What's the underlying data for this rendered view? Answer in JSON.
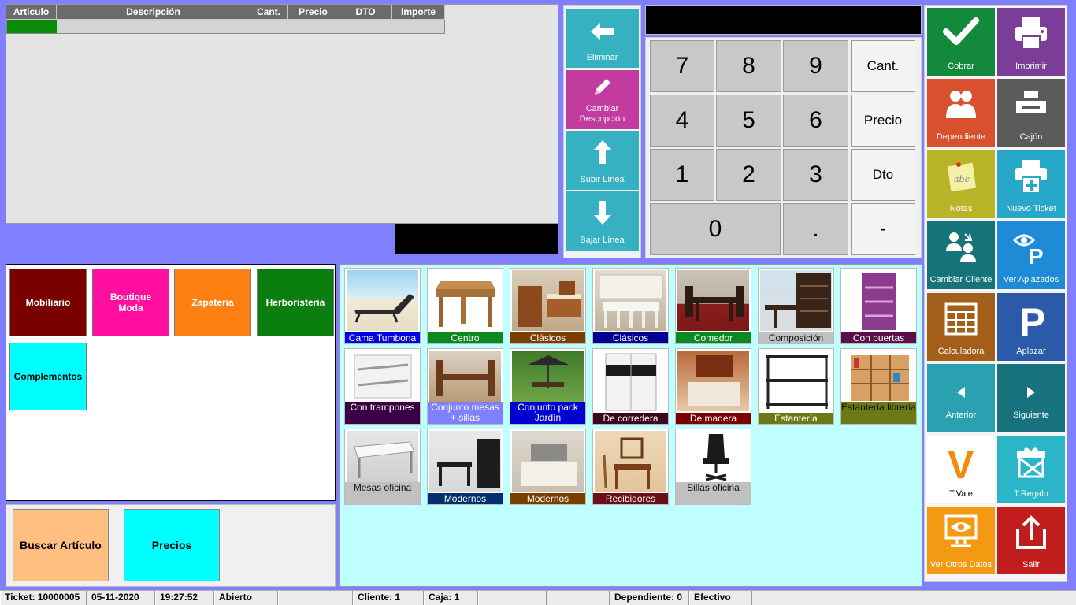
{
  "ticket_table": {
    "columns": [
      "Articulo",
      "Descripción",
      "Cant.",
      "Precio",
      "DTO",
      "Importe"
    ]
  },
  "actions": [
    {
      "label": "Eliminar",
      "color": "#36b1c2",
      "icon": "arrow-left-icon"
    },
    {
      "label": "Cambiar Descripción",
      "color": "#c23b9e",
      "icon": "pencil-icon"
    },
    {
      "label": "Subir Línea",
      "color": "#36b1c2",
      "icon": "arrow-up-icon"
    },
    {
      "label": "Bajar Línea",
      "color": "#36b1c2",
      "icon": "arrow-down-icon"
    }
  ],
  "keypad": {
    "k7": "7",
    "k8": "8",
    "k9": "9",
    "k4": "4",
    "k5": "5",
    "k6": "6",
    "k1": "1",
    "k2": "2",
    "k3": "3",
    "k0": "0",
    "kdot": ".",
    "kminus": "-",
    "cant": "Cant.",
    "precio": "Precio",
    "dto": "Dto"
  },
  "tiles": [
    {
      "label": "Cobrar",
      "color": "#138a3b",
      "icon": "checkmark-icon"
    },
    {
      "label": "Imprimir",
      "color": "#7a3d98",
      "icon": "printer-icon"
    },
    {
      "label": "Dependiente",
      "color": "#d9502f",
      "icon": "users-icon"
    },
    {
      "label": "Cajón",
      "color": "#5b5b5b",
      "icon": "cash-drawer-icon"
    },
    {
      "label": "Notas",
      "color": "#b9b328",
      "icon": "sticky-note-icon"
    },
    {
      "label": "Nuevo Ticket",
      "color": "#27a8c8",
      "icon": "printer-plus-icon"
    },
    {
      "label": "Cambiar Cliente",
      "color": "#17737a",
      "icon": "swap-users-icon"
    },
    {
      "label": "Ver Aplazados",
      "color": "#1e8bd6",
      "icon": "eye-parking-icon"
    },
    {
      "label": "Calculadora",
      "color": "#a35f1a",
      "icon": "calculator-icon"
    },
    {
      "label": "Aplazar",
      "color": "#2a5aa8",
      "icon": "parking-icon"
    },
    {
      "label": "Anterior",
      "color": "#2aa1b1",
      "icon": "triangle-left-icon"
    },
    {
      "label": "Siguiente",
      "color": "#17727e",
      "icon": "triangle-right-icon"
    },
    {
      "label": "T.Vale",
      "color": "#ffffff",
      "icon": "letter-v-icon"
    },
    {
      "label": "T.Regalo",
      "color": "#2ab5c8",
      "icon": "gift-icon"
    },
    {
      "label": "Ver Otros Datos",
      "color": "#f39a12",
      "icon": "monitor-eye-icon"
    },
    {
      "label": "Salir",
      "color": "#c21d1d",
      "icon": "export-icon"
    }
  ],
  "families": [
    {
      "label": "Mobiliario",
      "bg": "#7a0000",
      "fg": "#ffffff"
    },
    {
      "label": "Boutique Moda",
      "bg": "#ff0ea0",
      "fg": "#ffffff"
    },
    {
      "label": "Zapateria",
      "bg": "#ff8012",
      "fg": "#ffffff"
    },
    {
      "label": "Herboristeria",
      "bg": "#0a7f10",
      "fg": "#ffffff"
    },
    {
      "label": "Complementos",
      "bg": "#00ffff",
      "fg": "#000000"
    }
  ],
  "bottom_buttons": {
    "buscar": "Buscar Artículo",
    "precios": "Precios"
  },
  "products": [
    {
      "label": "Cama Tumbona",
      "color": "#0000e0"
    },
    {
      "label": "Centro",
      "color": "#0a8a1e"
    },
    {
      "label": "Clásicos",
      "color": "#7a3e00"
    },
    {
      "label": "Clásicos",
      "color": "#000090"
    },
    {
      "label": "Comedor",
      "color": "#0a8a1e"
    },
    {
      "label": "Composición",
      "color": "#c0c0c0"
    },
    {
      "label": "Con puertas",
      "color": "#5a0f4a"
    },
    {
      "label": "Con trampones",
      "color": "#3a0044"
    },
    {
      "label": "Conjunto mesas + sillas",
      "color": "#8080ff"
    },
    {
      "label": "Conjunto pack Jardín",
      "color": "#0000d0"
    },
    {
      "label": "De corredera",
      "color": "#3c0620"
    },
    {
      "label": "De madera",
      "color": "#7a0000"
    },
    {
      "label": "Estantería",
      "color": "#6b7a14"
    },
    {
      "label": "Estantería librería",
      "color": "#6b7a14"
    },
    {
      "label": "Mesas oficina",
      "color": "#c0c0c0"
    },
    {
      "label": "Modernos",
      "color": "#00306e"
    },
    {
      "label": "Modernos",
      "color": "#7a3e00"
    },
    {
      "label": "Recibidores",
      "color": "#6a1016"
    },
    {
      "label": "Sillas oficina",
      "color": "#c0c0c0"
    }
  ],
  "status": {
    "ticket": "Ticket: 10000005",
    "date": "05-11-2020",
    "time": "19:27:52",
    "state": "Abierto",
    "client": "Cliente: 1",
    "caja": "Caja: 1",
    "dependiente": "Dependiente: 0",
    "pago": "Efectivo"
  }
}
